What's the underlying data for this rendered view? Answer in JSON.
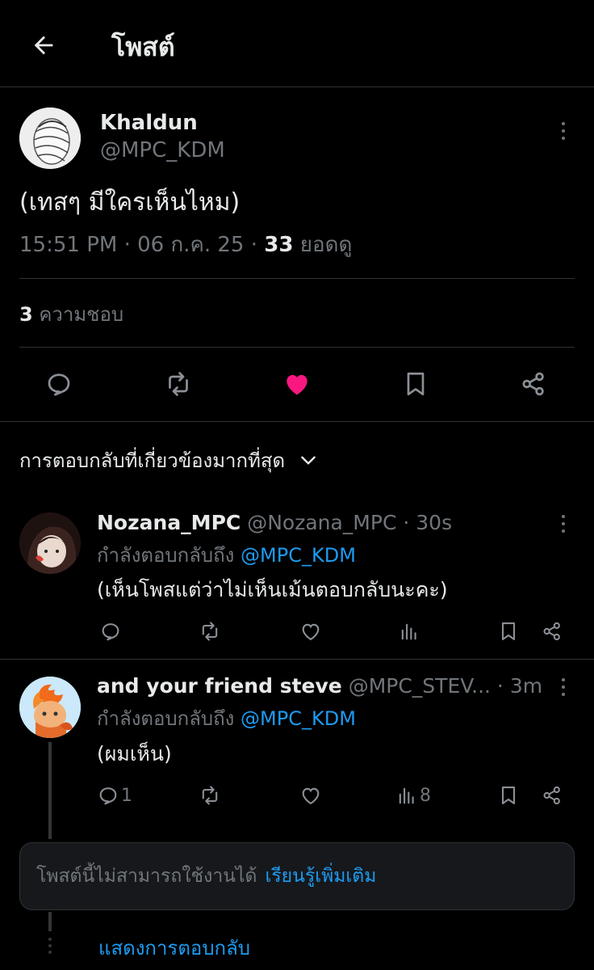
{
  "header": {
    "back_icon": "arrow-left-icon",
    "title": "โพสต์"
  },
  "post": {
    "author_name": "Khaldun",
    "author_handle": "@MPC_KDM",
    "text": "(เทสๆ มีใครเห็นไหม)",
    "time": "15:51 PM",
    "date": "06 ก.ค. 25",
    "separator": "·",
    "views_count": "33",
    "views_label": "ยอดดู",
    "likes_count": "3",
    "likes_label": "ความชอบ",
    "actions": [
      "reply-icon",
      "repost-icon",
      "heart-filled-icon",
      "bookmark-icon",
      "share-icon"
    ],
    "like_color": "#f91880"
  },
  "replies_sort": {
    "label": "การตอบกลับที่เกี่ยวข้องมากที่สุด"
  },
  "replies": [
    {
      "name": "Nozana_MPC",
      "handle": "@Nozana_MPC",
      "time": "30s",
      "replying_to_prefix": "กำลังตอบกลับถึง",
      "replying_to": "@MPC_KDM",
      "text": "(เห็นโพสแต่ว่าไม่เห็นเม้นตอบกลับนะคะ)",
      "reply_count": "",
      "view_count": ""
    },
    {
      "name": "and your friend steve",
      "handle": "@MPC_STEV...",
      "time": "3m",
      "replying_to_prefix": "กำลังตอบกลับถึง",
      "replying_to": "@MPC_KDM",
      "text": "(ผมเห็น)",
      "reply_count": "1",
      "view_count": "8"
    }
  ],
  "unavailable": {
    "text": "โพสต์นี้ไม่สามารถใช้งานได้",
    "link": "เรียนรู้เพิ่มเติม"
  },
  "show_replies": "แสดงการตอบกลับ",
  "colors": {
    "background": "#000000",
    "text": "#e7e9ea",
    "muted": "#71767b",
    "accent": "#1d9bf0",
    "divider": "#2f3336"
  }
}
